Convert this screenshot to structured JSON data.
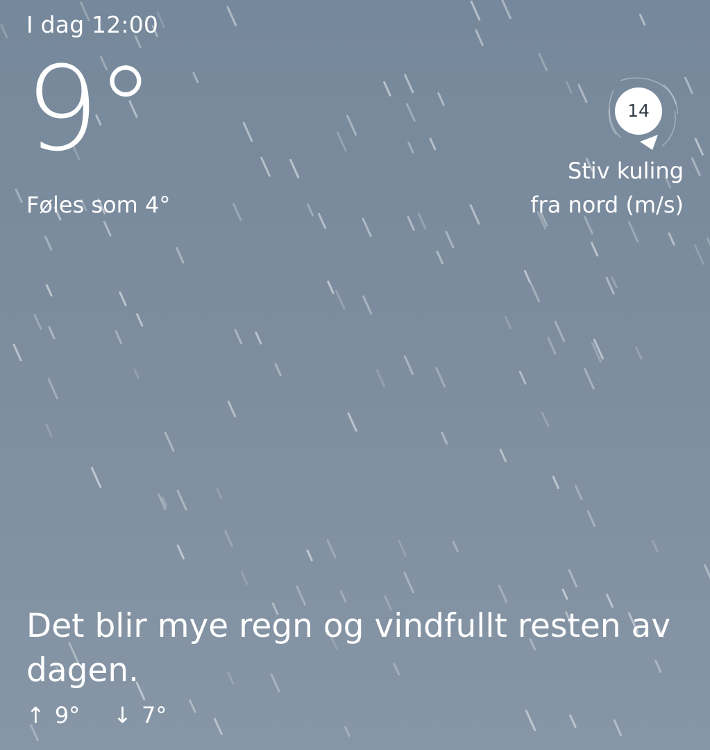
{
  "header": {
    "timestamp": "I dag 12:00"
  },
  "current": {
    "temperature": "9°",
    "feels_like": "Føles som 4°"
  },
  "wind": {
    "speed": "14",
    "strength_label": "Stiv kuling",
    "direction_label": "fra nord (m/s)",
    "icon": "wind-direction-icon"
  },
  "forecast": {
    "summary": "Det blir mye regn og vindfullt resten av dagen.",
    "high": "9°",
    "low": "7°",
    "high_icon": "arrow-up-icon",
    "low_icon": "arrow-down-icon"
  },
  "colors": {
    "background_top": "#76889b",
    "background_bottom": "#8696a6",
    "text": "#ffffff",
    "badge_text": "#2f3b46"
  }
}
